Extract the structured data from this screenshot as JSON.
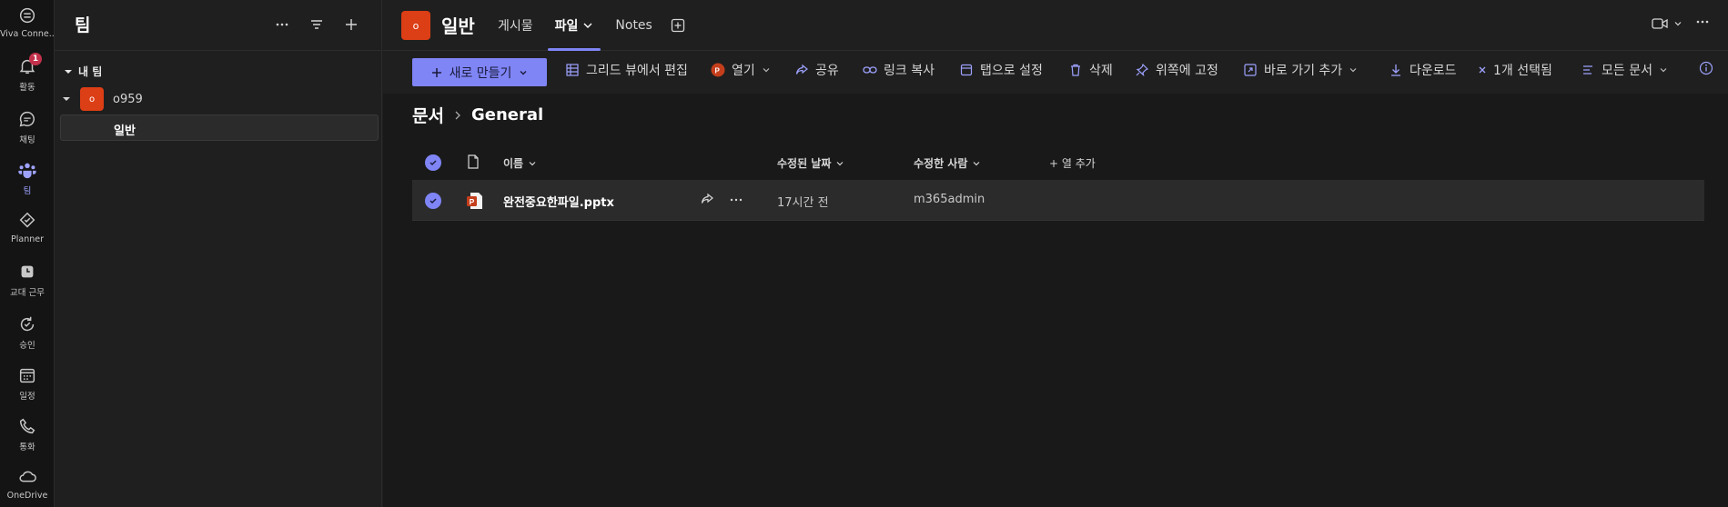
{
  "rail": [
    {
      "label": "Viva Conne...",
      "icon": "viva-connections-icon"
    },
    {
      "label": "활동",
      "icon": "bell-icon",
      "badge": "1"
    },
    {
      "label": "채팅",
      "icon": "chat-icon"
    },
    {
      "label": "팀",
      "icon": "teams-icon"
    },
    {
      "label": "Planner",
      "icon": "planner-icon"
    },
    {
      "label": "교대 근무",
      "icon": "shifts-icon"
    },
    {
      "label": "승인",
      "icon": "approvals-icon"
    },
    {
      "label": "일정",
      "icon": "calendar-icon"
    },
    {
      "label": "통화",
      "icon": "phone-icon"
    },
    {
      "label": "OneDrive",
      "icon": "onedrive-icon"
    }
  ],
  "panel": {
    "title": "팀",
    "section": "내 팀",
    "team": {
      "avatar": "o",
      "name": "o959"
    },
    "channel": "일반"
  },
  "topbar": {
    "avatar": "o",
    "title": "일반",
    "tabs": [
      "게시물",
      "파일",
      "Notes"
    ]
  },
  "cmdbar": {
    "new": "새로 만들기",
    "grid": "그리드 뷰에서 편집",
    "open": "열기",
    "share": "공유",
    "copy_link": "링크 복사",
    "set_tab": "탭으로 설정",
    "delete": "삭제",
    "pin": "위쪽에 고정",
    "shortcut": "바로 가기 추가",
    "download": "다운로드",
    "selected": "1개 선택됨",
    "view": "모든 문서"
  },
  "breadcrumb": {
    "root": "문서",
    "current": "General"
  },
  "table": {
    "headers": {
      "name": "이름",
      "modified": "수정된 날짜",
      "modified_by": "수정한 사람",
      "add_column": "+ 열 추가"
    },
    "rows": [
      {
        "name": "완전중요한파일.pptx",
        "modified": "17시간 전",
        "modified_by": "m365admin"
      }
    ]
  },
  "colors": {
    "accent": "#7f85f5",
    "team_avatar": "#dc3e15",
    "badge": "#c4314b",
    "ppt": "#c43e1c"
  }
}
